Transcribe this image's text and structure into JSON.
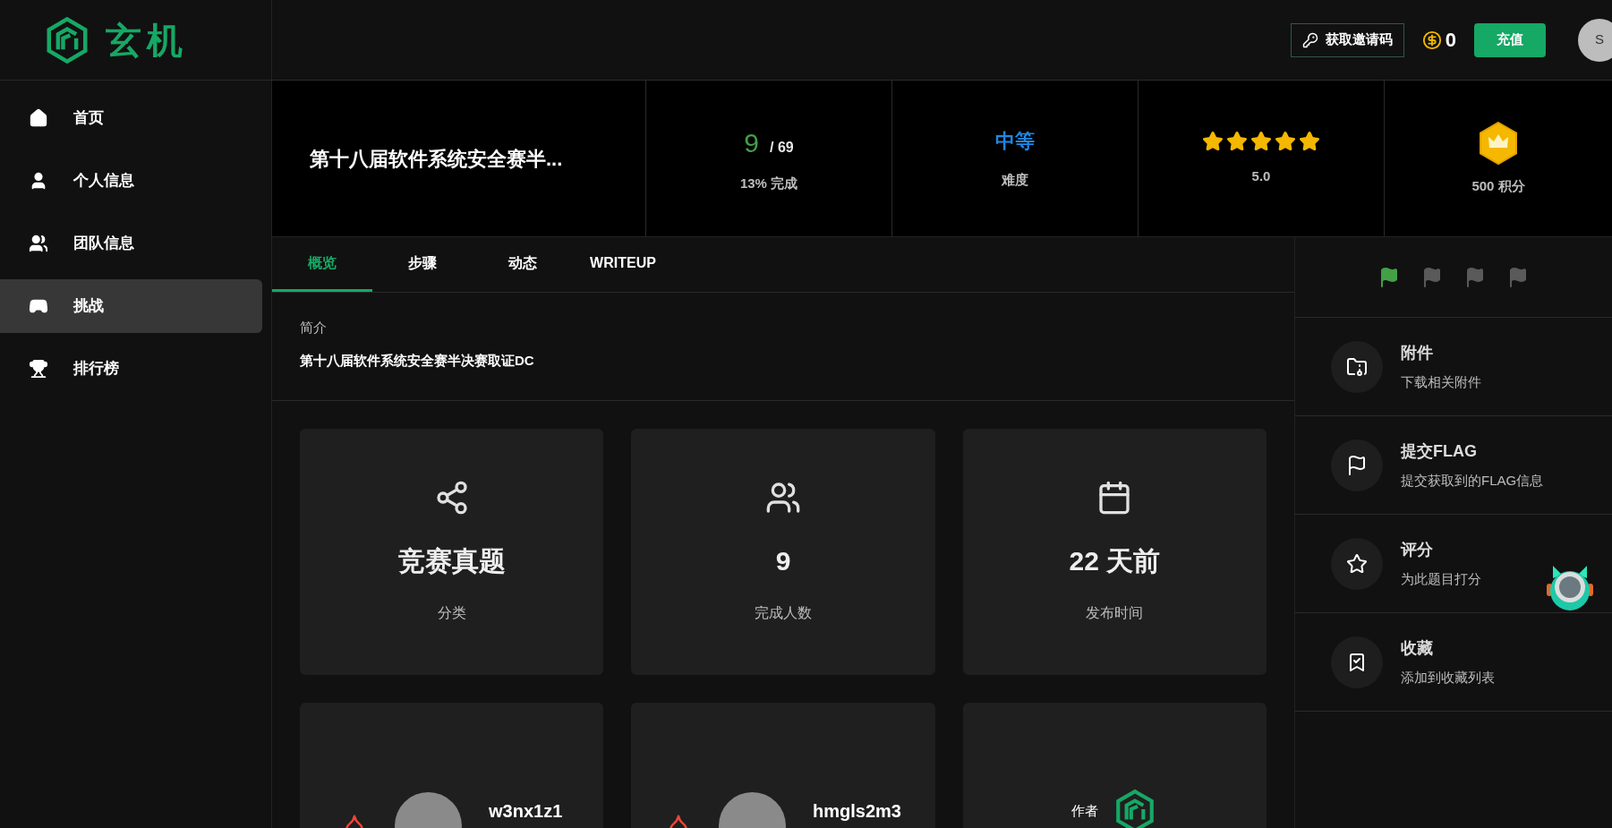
{
  "topbar": {
    "logo": "玄机",
    "invite_button": "获取邀请码",
    "coins": "0",
    "recharge_button": "充值",
    "avatar": "S"
  },
  "sidebar": {
    "items": [
      {
        "label": "首页",
        "selected": false
      },
      {
        "label": "个人信息",
        "selected": false
      },
      {
        "label": "团队信息",
        "selected": false
      },
      {
        "label": "挑战",
        "selected": true
      },
      {
        "label": "排行榜",
        "selected": false
      }
    ]
  },
  "challenge": {
    "title": "第十八届软件系统安全赛半...",
    "solved": "9",
    "total": "/ 69",
    "progress": "13% 完成",
    "difficulty": "中等",
    "difficulty_label": "难度",
    "stars": 5,
    "rating": "5.0",
    "points": "500 积分"
  },
  "tabs": [
    {
      "label": "概览",
      "selected": true
    },
    {
      "label": "步骤",
      "selected": false
    },
    {
      "label": "动态",
      "selected": false
    },
    {
      "label": "WRITEUP",
      "selected": false
    }
  ],
  "intro": {
    "label": "简介",
    "text": "第十八届软件系统安全赛半决赛取证DC"
  },
  "info_cards": [
    {
      "value": "竞赛真题",
      "label": "分类"
    },
    {
      "value": "9",
      "label": "完成人数"
    },
    {
      "value": "22 天前",
      "label": "发布时间"
    }
  ],
  "solver_cards": [
    {
      "name": "w3nx1z1"
    },
    {
      "name": "hmgls2m3"
    }
  ],
  "author_card": {
    "label": "作者"
  },
  "flags": [
    {
      "captured": true
    },
    {
      "captured": false
    },
    {
      "captured": false
    },
    {
      "captured": false
    }
  ],
  "actions": [
    {
      "title": "附件",
      "subtitle": "下载相关附件"
    },
    {
      "title": "提交FLAG",
      "subtitle": "提交获取到的FLAG信息"
    },
    {
      "title": "评分",
      "subtitle": "为此题目打分"
    },
    {
      "title": "收藏",
      "subtitle": "添加到收藏列表"
    }
  ]
}
